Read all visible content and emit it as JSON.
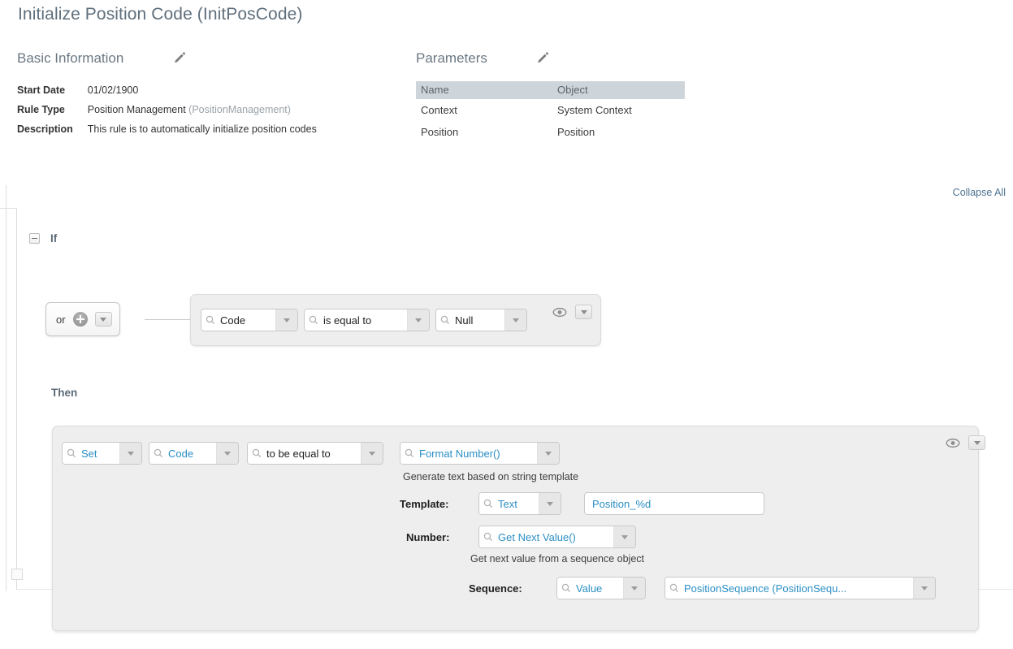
{
  "page": {
    "title": "Initialize Position Code (InitPosCode)",
    "collapse_all": "Collapse All"
  },
  "basic_information": {
    "heading": "Basic Information",
    "edit_icon": "pencil-icon",
    "fields": [
      {
        "label": "Start Date",
        "value": "01/02/1900",
        "suffix": ""
      },
      {
        "label": "Rule Type",
        "value": "Position Management",
        "suffix": "(PositionManagement)"
      },
      {
        "label": "Description",
        "value": "This rule is to automatically initialize position codes",
        "suffix": ""
      }
    ]
  },
  "parameters": {
    "heading": "Parameters",
    "edit_icon": "pencil-icon",
    "columns": [
      "Name",
      "Object"
    ],
    "rows": [
      {
        "name": "Context",
        "object": "System Context"
      },
      {
        "name": "Position",
        "object": "Position"
      }
    ]
  },
  "rule": {
    "if_label": "If",
    "then_label": "Then",
    "operator": {
      "label": "or",
      "add_icon": "plus-circle-icon",
      "menu_icon": "caret-down-icon"
    },
    "condition": {
      "subject": "Code",
      "comparator": "is equal to",
      "value": "Null",
      "visibility_icon": "eye-icon",
      "menu_icon": "caret-down-icon"
    },
    "action": {
      "verb": "Set",
      "target": "Code",
      "comparator": "to be equal to",
      "function": "Format Number()",
      "function_description": "Generate text based on string template",
      "visibility_icon": "eye-icon",
      "menu_icon": "caret-down-icon",
      "template": {
        "label": "Template:",
        "type": "Text",
        "value": "Position_%d",
        "placeholder": ""
      },
      "number": {
        "label": "Number:",
        "function": "Get Next Value()",
        "function_description": "Get next value from a sequence object",
        "sequence": {
          "label": "Sequence:",
          "type": "Value",
          "value": "PositionSequence (PositionSequ..."
        }
      }
    }
  },
  "colors": {
    "link": "#2b8fc4",
    "title": "#5f6f7c",
    "card_bg": "#eeeeee",
    "table_header_bg": "#ced5da"
  }
}
